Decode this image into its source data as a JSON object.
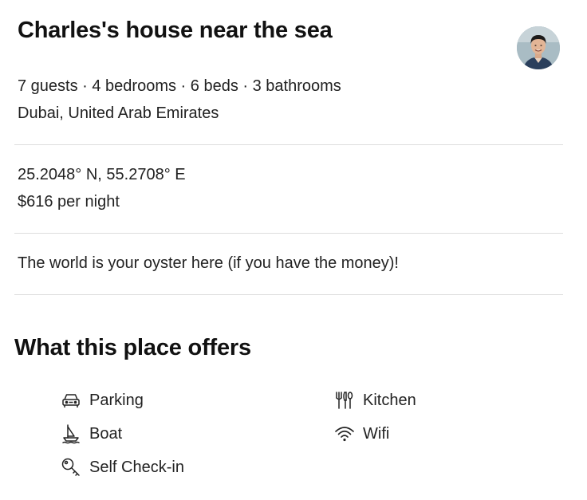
{
  "listing": {
    "title": "Charles's house near the sea",
    "summary": "7 guests · 4 bedrooms · 6 beds · 3 bathrooms",
    "location": "Dubai, United Arab Emirates",
    "coordinates": "25.2048° N, 55.2708° E",
    "price": "$616 per night",
    "description": "The world is your oyster here (if you have the money)!"
  },
  "host": {
    "avatar_icon": "host-avatar"
  },
  "amenities": {
    "title": "What this place offers",
    "items": [
      {
        "label": "Parking",
        "icon": "car-icon"
      },
      {
        "label": "Kitchen",
        "icon": "utensils-icon"
      },
      {
        "label": "Boat",
        "icon": "sailboat-icon"
      },
      {
        "label": "Wifi",
        "icon": "wifi-icon"
      },
      {
        "label": "Self Check-in",
        "icon": "key-icon"
      }
    ]
  }
}
